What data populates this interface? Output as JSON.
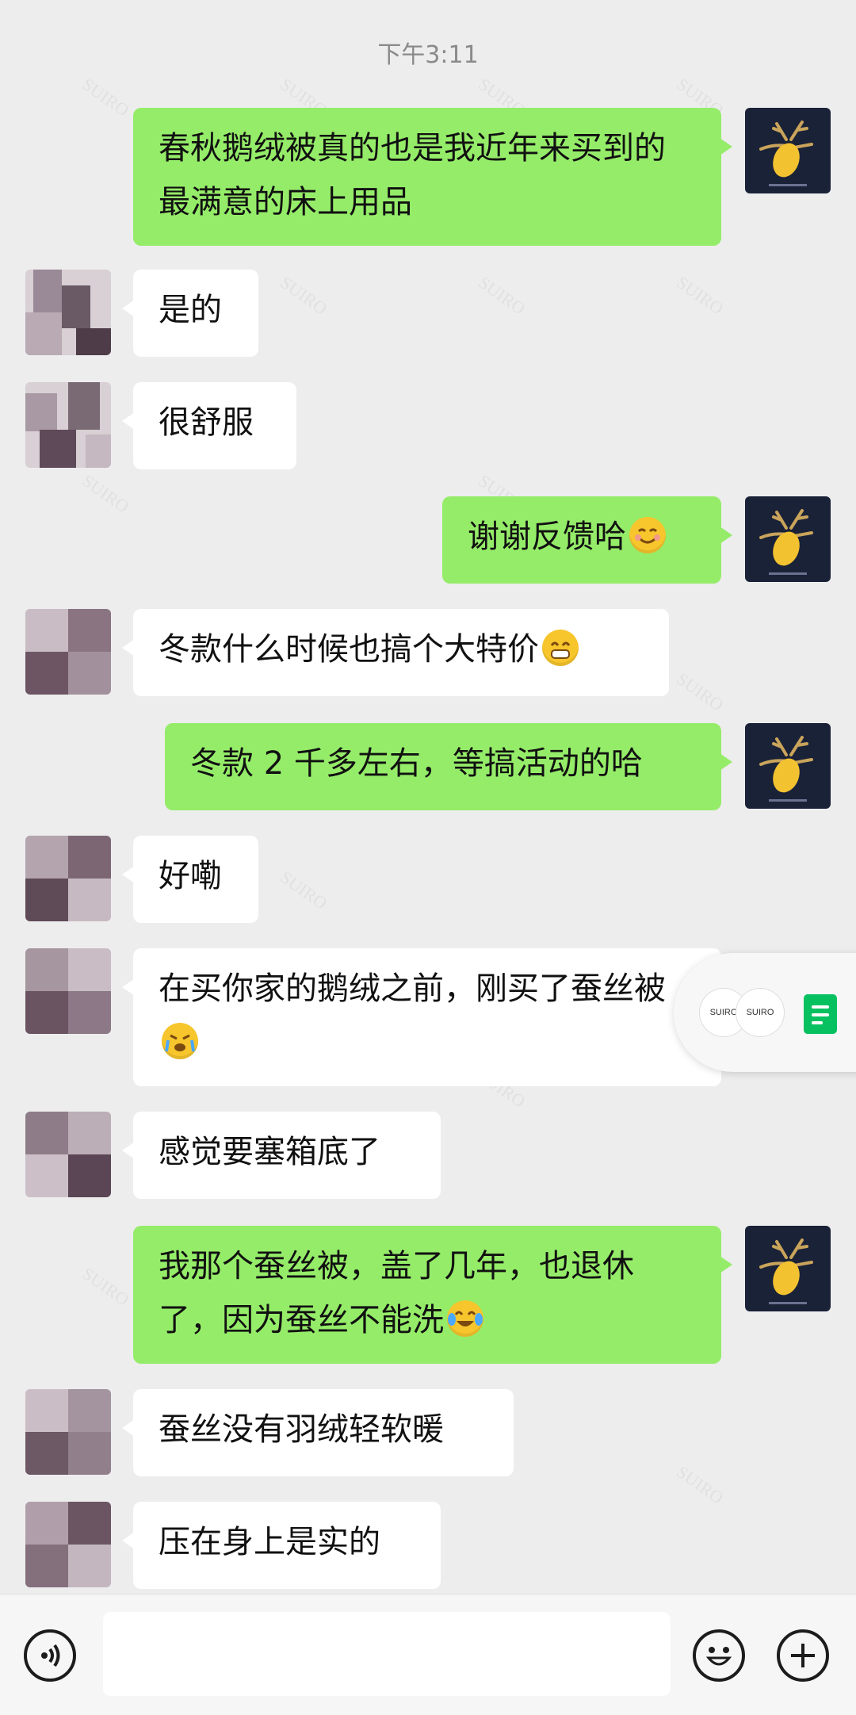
{
  "chat": {
    "time": "下午3:11",
    "watermark_text": "SUIRO",
    "messages": [
      {
        "id": "m1",
        "side": "me",
        "text": "春秋鹅绒被真的也是我近年来买到的最满意的床上用品"
      },
      {
        "id": "m2",
        "side": "them",
        "text": "是的"
      },
      {
        "id": "m3",
        "side": "them",
        "text": "很舒服"
      },
      {
        "id": "m4",
        "side": "me",
        "text": "谢谢反馈哈",
        "emoji": "smiling-face-icon"
      },
      {
        "id": "m5",
        "side": "them",
        "text": "冬款什么时候也搞个大特价",
        "emoji": "grinning-face-icon"
      },
      {
        "id": "m6",
        "side": "me",
        "text": "冬款 2 千多左右，等搞活动的哈"
      },
      {
        "id": "m7",
        "side": "them",
        "text": "好嘞"
      },
      {
        "id": "m8",
        "side": "them",
        "text": "在买你家的鹅绒之前，刚买了蚕丝被",
        "emoji": "crying-face-icon"
      },
      {
        "id": "m9",
        "side": "them",
        "text": "感觉要塞箱底了"
      },
      {
        "id": "m10",
        "side": "me",
        "text": "我那个蚕丝被，盖了几年，也退休了，因为蚕丝不能洗",
        "emoji": "tears-of-joy-icon"
      },
      {
        "id": "m11",
        "side": "them",
        "text": "蚕丝没有羽绒轻软暖"
      },
      {
        "id": "m12",
        "side": "them",
        "text": "压在身上是实的"
      }
    ]
  },
  "floating_panel": {
    "mini_avatar_1": "SUIRO",
    "mini_avatar_2": "SUIRO",
    "doc_icon": "document-icon"
  },
  "input_bar": {
    "voice_icon": "voice-icon",
    "emoji_icon": "emoji-icon",
    "plus_icon": "plus-icon",
    "input_value": ""
  },
  "colors": {
    "background": "#ededed",
    "my_bubble": "#95ec69",
    "their_bubble": "#ffffff",
    "my_avatar": "#1a2238",
    "mango": "#f2c230"
  }
}
